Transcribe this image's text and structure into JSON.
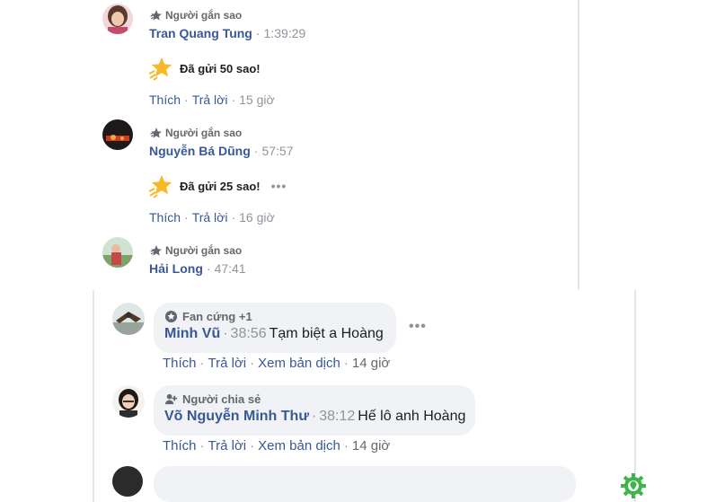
{
  "stars_feed": [
    {
      "badge": "Người gắn sao",
      "name": "Tran Quang Tung",
      "time": "1:39:29",
      "stars_text": "Đã gửi 50 sao!",
      "like": "Thích",
      "reply": "Trả lời",
      "age": "15 giờ",
      "avatar_icon": "avatar-girl-photo"
    },
    {
      "badge": "Người gắn sao",
      "name": "Nguyễn Bá Dũng",
      "time": "57:57",
      "stars_text": "Đã gửi 25 sao!",
      "more": "•••",
      "like": "Thích",
      "reply": "Trả lời",
      "age": "16 giờ",
      "avatar_icon": "avatar-dark-photo"
    },
    {
      "badge": "Người gắn sao",
      "name": "Hải Long",
      "time": "47:41",
      "avatar_icon": "avatar-outdoor-photo"
    }
  ],
  "comments": [
    {
      "badge": "Fan cứng +1",
      "name": "Minh Vũ",
      "time": "38:56",
      "message": "Tạm biệt a Hoàng",
      "more": "•••",
      "like": "Thích",
      "reply": "Trả lời",
      "translate": "Xem bản dịch",
      "age": "14 giờ"
    },
    {
      "badge": "Người chia sẻ",
      "name": "Võ Nguyễn Minh Thư",
      "time": "38:12",
      "message": "Hế lô anh Hoàng",
      "like": "Thích",
      "reply": "Trả lời",
      "translate": "Xem bản dịch",
      "age": "14 giờ"
    }
  ],
  "colors": {
    "link": "#385898",
    "muted": "#90949c",
    "bubble": "#f0f2f5",
    "star": "#f7b928",
    "watermark_green": "#3db54a"
  }
}
